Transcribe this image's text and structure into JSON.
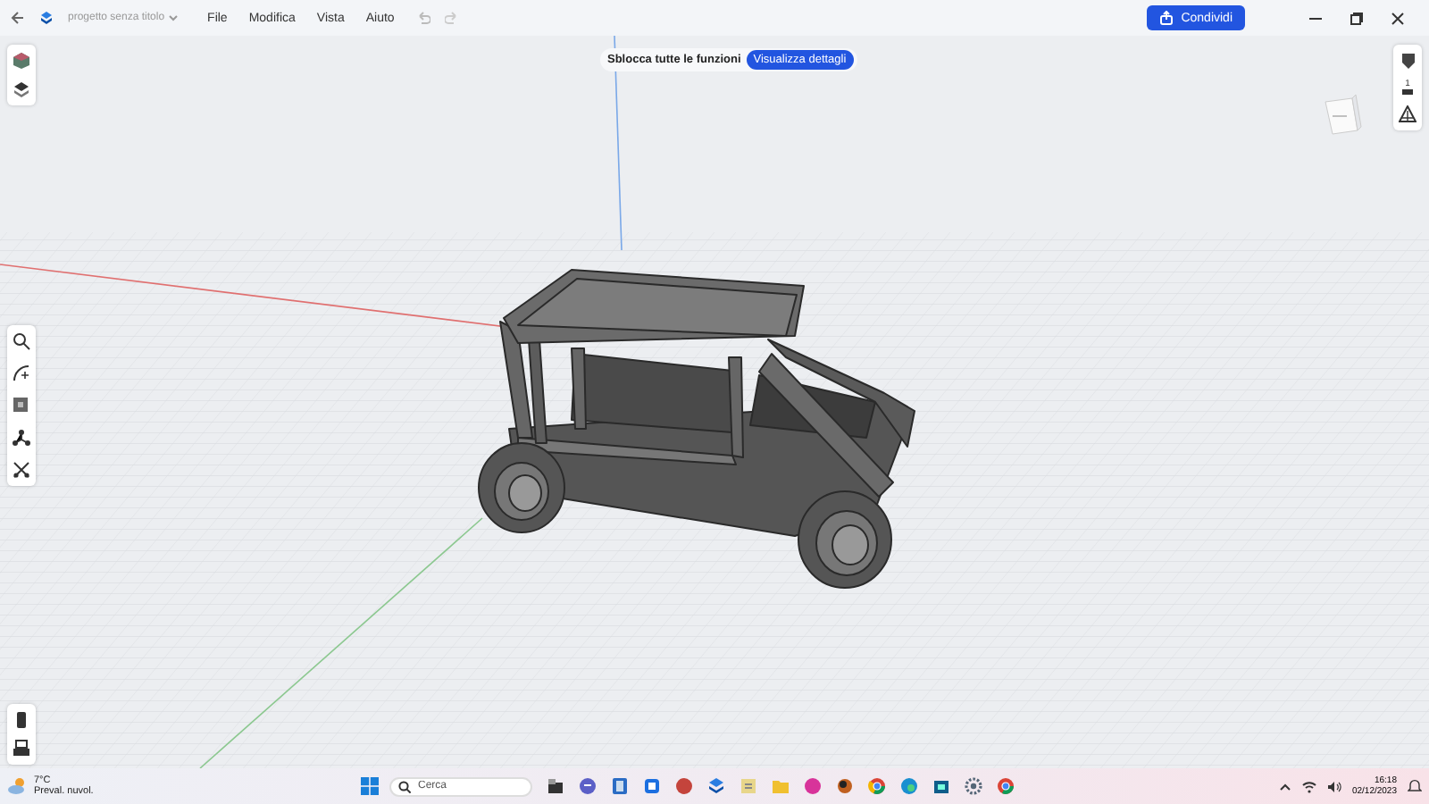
{
  "window": {
    "project_name": "progetto senza titolo",
    "menu": [
      "File",
      "Modifica",
      "Vista",
      "Aiuto"
    ],
    "share_button": "Condividi"
  },
  "banner": {
    "text": "Sblocca tutte le funzioni",
    "button": "Visualizza dettagli"
  },
  "navigation": {
    "scale_label": "1"
  },
  "taskbar": {
    "temperature": "7°C",
    "weather": "Preval. nuvol.",
    "search_placeholder": "Cerca",
    "time": "16:18",
    "date": "02/12/2023"
  }
}
